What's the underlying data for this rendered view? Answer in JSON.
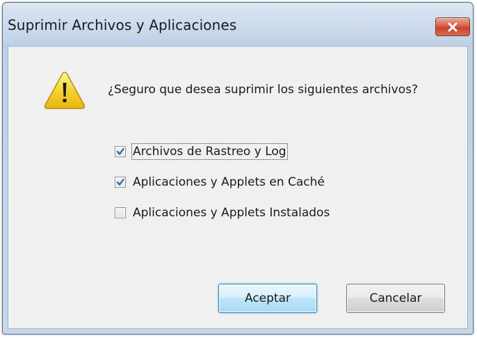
{
  "window": {
    "title": "Suprimir Archivos y Aplicaciones",
    "close_icon": "close-icon"
  },
  "dialog": {
    "icon": "warning-icon",
    "question": "¿Seguro que desea suprimir los siguientes archivos?",
    "options": [
      {
        "label": "Archivos de Rastreo y Log",
        "checked": true
      },
      {
        "label": "Aplicaciones y Applets en Caché",
        "checked": true
      },
      {
        "label": "Aplicaciones y Applets Instalados",
        "checked": false
      }
    ]
  },
  "buttons": {
    "ok_label": "Aceptar",
    "cancel_label": "Cancelar"
  },
  "colors": {
    "close_button": "#c7432b",
    "default_button_border": "#3c7fb1",
    "warning_fill": "#f5d233"
  }
}
